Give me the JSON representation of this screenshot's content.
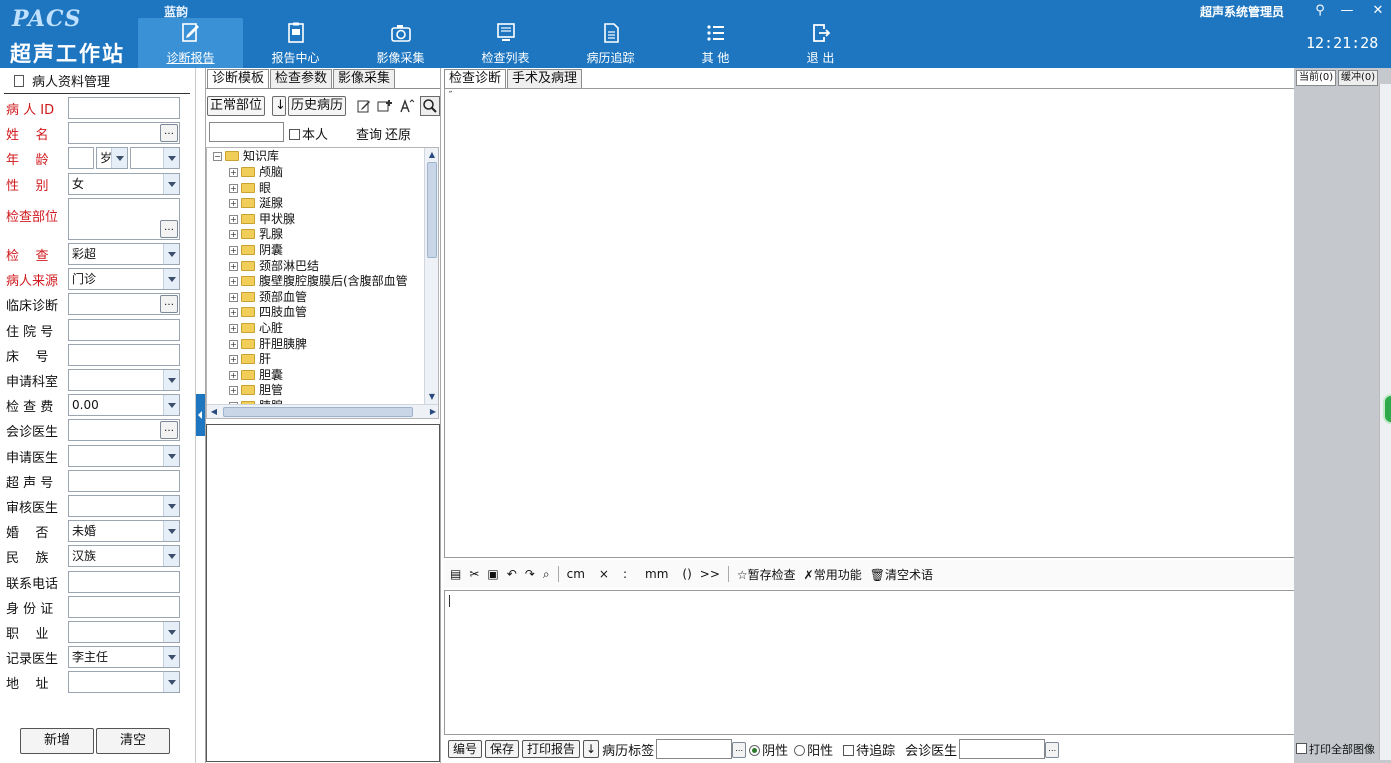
{
  "header": {
    "logo_text": "PACS",
    "app_title": "超声工作站",
    "vendor": "蓝韵",
    "user_name": "超声系统管理员",
    "clock": "12:21:28",
    "nav": [
      {
        "label": "诊断报告",
        "icon": "edit-report-icon"
      },
      {
        "label": "报告中心",
        "icon": "report-center-icon"
      },
      {
        "label": "影像采集",
        "icon": "camera-icon"
      },
      {
        "label": "检查列表",
        "icon": "monitor-icon"
      },
      {
        "label": "病历追踪",
        "icon": "record-icon"
      },
      {
        "label": "其 他",
        "icon": "list-icon"
      },
      {
        "label": "退 出",
        "icon": "exit-icon"
      }
    ],
    "window_buttons": {
      "settings": "⚲",
      "minimize": "—",
      "close": "✕"
    }
  },
  "patient_panel": {
    "title": "病人资料管理",
    "fields": [
      {
        "label": "病 人 ID",
        "value": "",
        "required": true,
        "kind": "text"
      },
      {
        "label": "姓    名",
        "value": "",
        "required": true,
        "kind": "browse"
      },
      {
        "label": "年    龄",
        "value": "",
        "required": true,
        "kind": "age",
        "unit": "岁"
      },
      {
        "label": "性    别",
        "value": "女",
        "required": true,
        "kind": "select"
      },
      {
        "label": "检查部位",
        "value": "",
        "required": true,
        "kind": "area"
      },
      {
        "label": "检    查",
        "value": "彩超",
        "required": true,
        "kind": "select"
      },
      {
        "label": "病人来源",
        "value": "门诊",
        "required": true,
        "kind": "select"
      },
      {
        "label": "临床诊断",
        "value": "",
        "required": false,
        "kind": "browse"
      },
      {
        "label": "住 院 号",
        "value": "",
        "required": false,
        "kind": "text"
      },
      {
        "label": "床    号",
        "value": "",
        "required": false,
        "kind": "text"
      },
      {
        "label": "申请科室",
        "value": "",
        "required": false,
        "kind": "select"
      },
      {
        "label": "检 查 费",
        "value": "0.00",
        "required": false,
        "kind": "select"
      },
      {
        "label": "会诊医生",
        "value": "",
        "required": false,
        "kind": "browse"
      },
      {
        "label": "申请医生",
        "value": "",
        "required": false,
        "kind": "select"
      },
      {
        "label": "超 声 号",
        "value": "",
        "required": false,
        "kind": "text"
      },
      {
        "label": "审核医生",
        "value": "",
        "required": false,
        "kind": "select"
      },
      {
        "label": "婚    否",
        "value": "未婚",
        "required": false,
        "kind": "select"
      },
      {
        "label": "民    族",
        "value": "汉族",
        "required": false,
        "kind": "select"
      },
      {
        "label": "联系电话",
        "value": "",
        "required": false,
        "kind": "text"
      },
      {
        "label": "身 份 证",
        "value": "",
        "required": false,
        "kind": "text"
      },
      {
        "label": "职    业",
        "value": "",
        "required": false,
        "kind": "select"
      },
      {
        "label": "记录医生",
        "value": "李主任",
        "required": false,
        "kind": "select"
      },
      {
        "label": "地    址",
        "value": "",
        "required": false,
        "kind": "select"
      }
    ],
    "buttons": {
      "add": "新增",
      "clear": "清空"
    }
  },
  "template_panel": {
    "tabs": [
      "诊断模板",
      "检查参数",
      "影像采集"
    ],
    "buttons": {
      "normal_part": "正常部位",
      "history": "历史病历"
    },
    "self_label": "本人",
    "query": "查询",
    "restore": "还原",
    "tree_root": "知识库",
    "tree_items": [
      "颅脑",
      "眼",
      "涎腺",
      "甲状腺",
      "乳腺",
      "阴囊",
      "颈部淋巴结",
      "腹壁腹腔腹膜后(含腹部血管",
      "颈部血管",
      "四肢血管",
      "心脏",
      "肝胆胰脾",
      "肝",
      "胆囊",
      "胆管",
      "胰腺"
    ]
  },
  "editor": {
    "tabs": [
      "检查诊断",
      "手术及病理"
    ],
    "toolbar": {
      "unit_cm": "cm",
      "times": "×",
      "colon": ":",
      "unit_mm": "mm",
      "parens": "()",
      "chevrons": ">>",
      "save_exam": "暂存检查",
      "common_func": "常用功能",
      "clear_terms": "清空术语"
    }
  },
  "bottom_bar": {
    "number": "编号",
    "save": "保存",
    "print_report": "打印报告",
    "record_tag": "病历标签",
    "negative": "阴性",
    "positive": "阳性",
    "pending_trace": "待追踪",
    "consult_doctor": "会诊医生",
    "print_all_images": "打印全部图像"
  },
  "image_panel": {
    "tabs": [
      "当前(0)",
      "缓冲(0)"
    ]
  }
}
